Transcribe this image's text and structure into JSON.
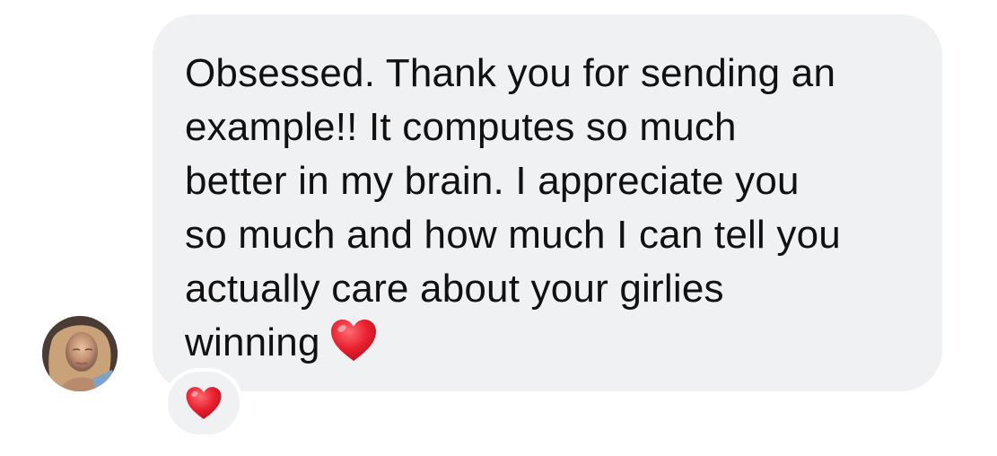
{
  "message": {
    "lines": [
      "Obsessed. Thank you for sending an",
      "example!! It computes so much",
      "better in my brain. I appreciate you",
      "so much and how much I can tell you",
      "actually care about your girlies",
      "winning"
    ],
    "trailing_emoji": "red-heart-icon"
  },
  "reaction": {
    "emoji": "red-heart-icon"
  },
  "colors": {
    "bubble_background": "#f0f1f3",
    "text": "#111111",
    "heart": "#e8202f"
  }
}
